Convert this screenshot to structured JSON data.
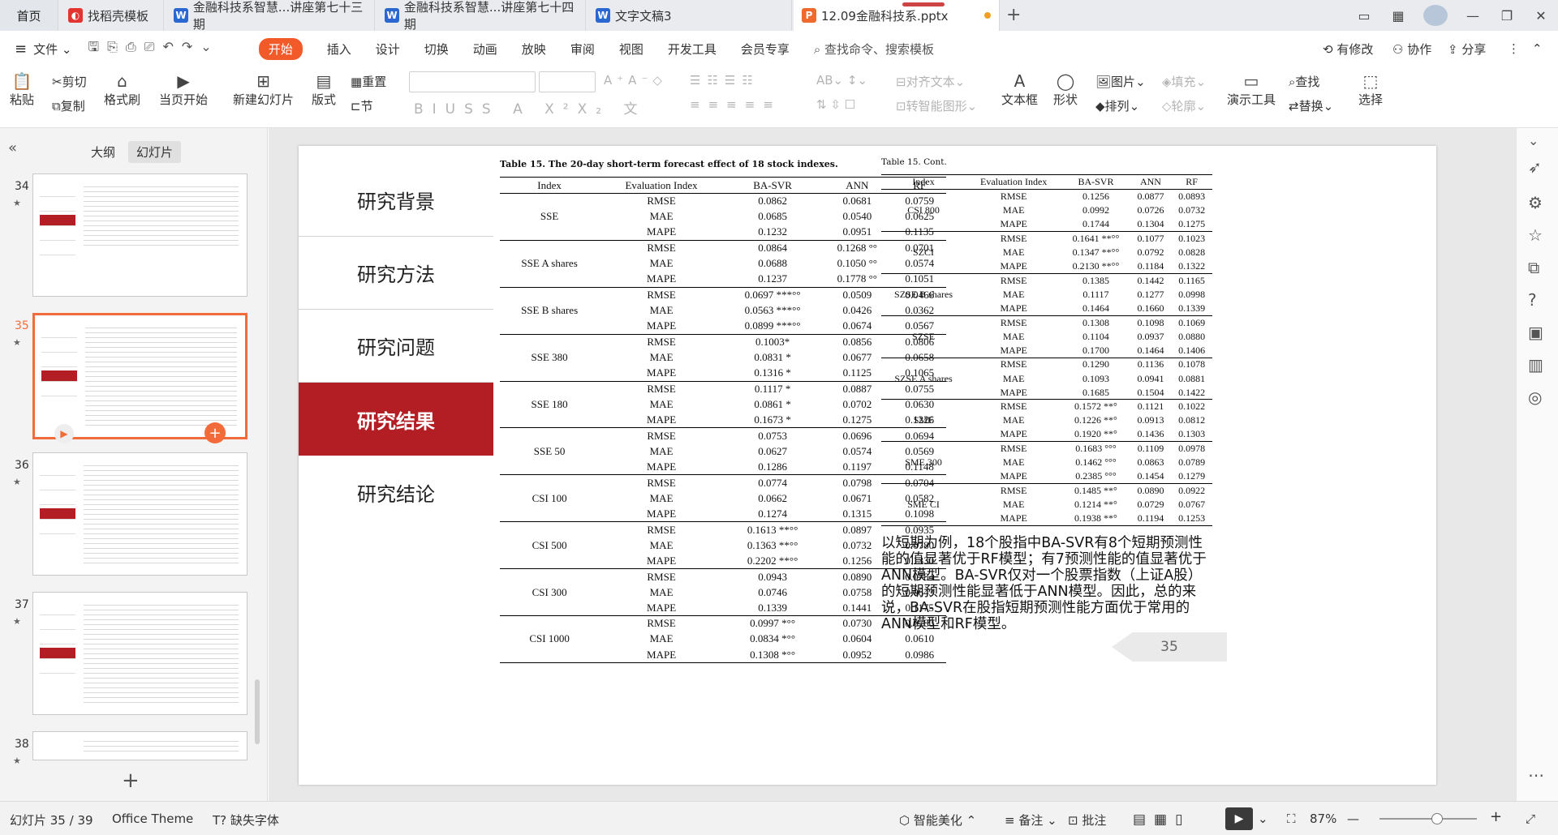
{
  "tabs": {
    "home": "首页",
    "t1": "找稻壳模板",
    "t2": "金融科技系智慧...讲座第七十三期",
    "t3": "金融科技系智慧...讲座第七十四期",
    "t4": "文字文稿3",
    "t5": "12.09金融科技系.pptx"
  },
  "menu": {
    "file": "文件",
    "items": [
      "开始",
      "插入",
      "设计",
      "切换",
      "动画",
      "放映",
      "审阅",
      "视图",
      "开发工具",
      "会员专享"
    ],
    "search": "查找命令、搜索模板",
    "modified": "有修改",
    "collab": "协作",
    "share": "分享"
  },
  "ribbon": {
    "paste": "粘贴",
    "cut": "剪切",
    "copy": "复制",
    "format_painter": "格式刷",
    "from_current": "当页开始",
    "new_slide": "新建幻灯片",
    "layout": "版式",
    "reset": "重置",
    "section": "节",
    "align_text": "对齐文本",
    "smart_art": "转智能图形",
    "textbox": "文本框",
    "shape": "形状",
    "picture": "图片",
    "fill": "填充",
    "arrange": "排列",
    "outline": "轮廓",
    "presenter": "演示工具",
    "find": "查找",
    "replace": "替换",
    "select": "选择"
  },
  "left": {
    "outline_tab": "大纲",
    "slides_tab": "幻灯片",
    "thumbs": [
      {
        "num": "34"
      },
      {
        "num": "35"
      },
      {
        "num": "36"
      },
      {
        "num": "37"
      },
      {
        "num": "38"
      }
    ]
  },
  "slide": {
    "nav": [
      "研究背景",
      "研究方法",
      "研究问题",
      "研究结果",
      "研究结论"
    ],
    "t1_title": "Table 15. The 20-day short-term forecast effect of 18 stock indexes.",
    "t2_title": "Table 15. Cont.",
    "headers": [
      "Index",
      "Evaluation Index",
      "BA-SVR",
      "ANN",
      "RF"
    ],
    "t1": [
      {
        "index": "SSE",
        "rows": [
          [
            "RMSE",
            "0.0862",
            "0.0681",
            "0.0759"
          ],
          [
            "MAE",
            "0.0685",
            "0.0540",
            "0.0625"
          ],
          [
            "MAPE",
            "0.1232",
            "0.0951",
            "0.1135"
          ]
        ]
      },
      {
        "index": "SSE A shares",
        "rows": [
          [
            "RMSE",
            "0.0864",
            "0.1268 °°",
            "0.0701"
          ],
          [
            "MAE",
            "0.0688",
            "0.1050 °°",
            "0.0574"
          ],
          [
            "MAPE",
            "0.1237",
            "0.1778 °°",
            "0.1051"
          ]
        ]
      },
      {
        "index": "SSE B shares",
        "rows": [
          [
            "RMSE",
            "0.0697 ***°°",
            "0.0509",
            "0.0466"
          ],
          [
            "MAE",
            "0.0563 ***°°",
            "0.0426",
            "0.0362"
          ],
          [
            "MAPE",
            "0.0899 ***°°",
            "0.0674",
            "0.0567"
          ]
        ]
      },
      {
        "index": "SSE 380",
        "rows": [
          [
            "RMSE",
            "0.1003*",
            "0.0856",
            "0.0806"
          ],
          [
            "MAE",
            "0.0831 *",
            "0.0677",
            "0.0658"
          ],
          [
            "MAPE",
            "0.1316 *",
            "0.1125",
            "0.1065"
          ]
        ]
      },
      {
        "index": "SSE 180",
        "rows": [
          [
            "RMSE",
            "0.1117 *",
            "0.0887",
            "0.0755"
          ],
          [
            "MAE",
            "0.0861 *",
            "0.0702",
            "0.0630"
          ],
          [
            "MAPE",
            "0.1673 *",
            "0.1275",
            "0.1226"
          ]
        ]
      },
      {
        "index": "SSE 50",
        "rows": [
          [
            "RMSE",
            "0.0753",
            "0.0696",
            "0.0694"
          ],
          [
            "MAE",
            "0.0627",
            "0.0574",
            "0.0569"
          ],
          [
            "MAPE",
            "0.1286",
            "0.1197",
            "0.1148"
          ]
        ]
      },
      {
        "index": "CSI 100",
        "rows": [
          [
            "RMSE",
            "0.0774",
            "0.0798",
            "0.0704"
          ],
          [
            "MAE",
            "0.0662",
            "0.0671",
            "0.0582"
          ],
          [
            "MAPE",
            "0.1274",
            "0.1315",
            "0.1098"
          ]
        ]
      },
      {
        "index": "CSI 500",
        "rows": [
          [
            "RMSE",
            "0.1613 **°°",
            "0.0897",
            "0.0935"
          ],
          [
            "MAE",
            "0.1363 **°°",
            "0.0732",
            "0.0780"
          ],
          [
            "MAPE",
            "0.2202 **°°",
            "0.1256",
            "0.1330"
          ]
        ]
      },
      {
        "index": "CSI 300",
        "rows": [
          [
            "RMSE",
            "0.0943",
            "0.0890",
            "0.0784"
          ],
          [
            "MAE",
            "0.0746",
            "0.0758",
            "0.0643"
          ],
          [
            "MAPE",
            "0.1339",
            "0.1441",
            "0.1175"
          ]
        ]
      },
      {
        "index": "CSI 1000",
        "rows": [
          [
            "RMSE",
            "0.0997 *°°",
            "0.0730",
            "0.0780"
          ],
          [
            "MAE",
            "0.0834 *°°",
            "0.0604",
            "0.0610"
          ],
          [
            "MAPE",
            "0.1308 *°°",
            "0.0952",
            "0.0986"
          ]
        ]
      }
    ],
    "t2": [
      {
        "index": "CSI 800",
        "rows": [
          [
            "RMSE",
            "0.1256",
            "0.0877",
            "0.0893"
          ],
          [
            "MAE",
            "0.0992",
            "0.0726",
            "0.0732"
          ],
          [
            "MAPE",
            "0.1744",
            "0.1304",
            "0.1275"
          ]
        ]
      },
      {
        "index": "SZCI",
        "rows": [
          [
            "RMSE",
            "0.1641 **°°",
            "0.1077",
            "0.1023"
          ],
          [
            "MAE",
            "0.1347 **°°",
            "0.0792",
            "0.0828"
          ],
          [
            "MAPE",
            "0.2130 **°°",
            "0.1184",
            "0.1322"
          ]
        ]
      },
      {
        "index": "SZSE B shares",
        "rows": [
          [
            "RMSE",
            "0.1385",
            "0.1442",
            "0.1165"
          ],
          [
            "MAE",
            "0.1117",
            "0.1277",
            "0.0998"
          ],
          [
            "MAPE",
            "0.1464",
            "0.1660",
            "0.1339"
          ]
        ]
      },
      {
        "index": "SZSE",
        "rows": [
          [
            "RMSE",
            "0.1308",
            "0.1098",
            "0.1069"
          ],
          [
            "MAE",
            "0.1104",
            "0.0937",
            "0.0880"
          ],
          [
            "MAPE",
            "0.1700",
            "0.1464",
            "0.1406"
          ]
        ]
      },
      {
        "index": "SZSE A shares",
        "rows": [
          [
            "RMSE",
            "0.1290",
            "0.1136",
            "0.1078"
          ],
          [
            "MAE",
            "0.1093",
            "0.0941",
            "0.0881"
          ],
          [
            "MAPE",
            "0.1685",
            "0.1504",
            "0.1422"
          ]
        ]
      },
      {
        "index": "SME",
        "rows": [
          [
            "RMSE",
            "0.1572 **°",
            "0.1121",
            "0.1022"
          ],
          [
            "MAE",
            "0.1226 **°",
            "0.0913",
            "0.0812"
          ],
          [
            "MAPE",
            "0.1920 **°",
            "0.1436",
            "0.1303"
          ]
        ]
      },
      {
        "index": "SME 300",
        "rows": [
          [
            "RMSE",
            "0.1683 °°°",
            "0.1109",
            "0.0978"
          ],
          [
            "MAE",
            "0.1462 °°°",
            "0.0863",
            "0.0789"
          ],
          [
            "MAPE",
            "0.2385 °°°",
            "0.1454",
            "0.1279"
          ]
        ]
      },
      {
        "index": "SME CI",
        "rows": [
          [
            "RMSE",
            "0.1485 **°",
            "0.0890",
            "0.0922"
          ],
          [
            "MAE",
            "0.1214 **°",
            "0.0729",
            "0.0767"
          ],
          [
            "MAPE",
            "0.1938 **°",
            "0.1194",
            "0.1253"
          ]
        ]
      }
    ],
    "note": "以短期为例，18个股指中BA-SVR有8个短期预测性能的值显著优于RF模型；有7预测性能的值显著优于ANN模型。BA-SVR仅对一个股票指数（上证A股）的短期预测性能显著低于ANN模型。因此，总的来说，BA-SVR在股指短期预测性能方面优于常用的ANN模型和RF模型。",
    "page": "35"
  },
  "status": {
    "slide_counter": "幻灯片 35 / 39",
    "theme": "Office Theme",
    "missing_font": "缺失字体",
    "beautify": "智能美化",
    "notes": "备注",
    "comment": "批注",
    "zoom": "87%"
  }
}
